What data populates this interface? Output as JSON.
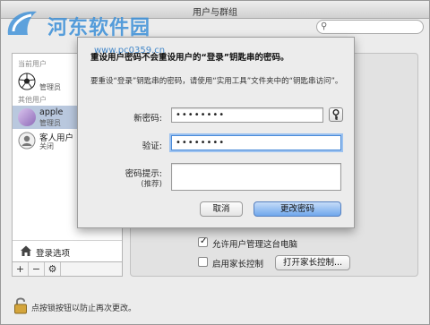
{
  "window": {
    "title": "用户与群组"
  },
  "sidebar": {
    "section_current": "当前用户",
    "section_other": "其他用户",
    "current_user": {
      "role": "管理员"
    },
    "users": [
      {
        "name": "apple",
        "role": "管理员",
        "selected": true
      },
      {
        "name": "客人用户",
        "role": "关闭",
        "selected": false
      }
    ],
    "login_options": "登录选项",
    "add_symbol": "+",
    "remove_symbol": "−",
    "gear_symbol": "⚙"
  },
  "panel": {
    "allow_admin_label": "允许用户管理这台电脑",
    "allow_admin_checked": true,
    "parental_label": "启用家长控制",
    "parental_checked": false,
    "parental_button": "打开家长控制..."
  },
  "lock": {
    "text": "点按锁按钮以防止再次更改。"
  },
  "dialog": {
    "title": "重设用户密码不会重设用户的“登录”钥匙串的密码。",
    "description": "要重设“登录”钥匙串的密码，请使用“实用工具”文件夹中的“钥匙串访问”。",
    "new_password_label": "新密码:",
    "new_password_value": "••••••••",
    "verify_label": "验证:",
    "verify_value": "••••••••",
    "hint_label": "密码提示:",
    "hint_sublabel": "(推荐)",
    "hint_value": "",
    "cancel_button": "取消",
    "change_button": "更改密码"
  },
  "watermark": {
    "text": "河东软件园",
    "url": "www.pc0359.cn"
  },
  "colors": {
    "accent": "#6fa7ec",
    "selection": "#b9c8de",
    "focus_ring": "#9cc2f0"
  }
}
